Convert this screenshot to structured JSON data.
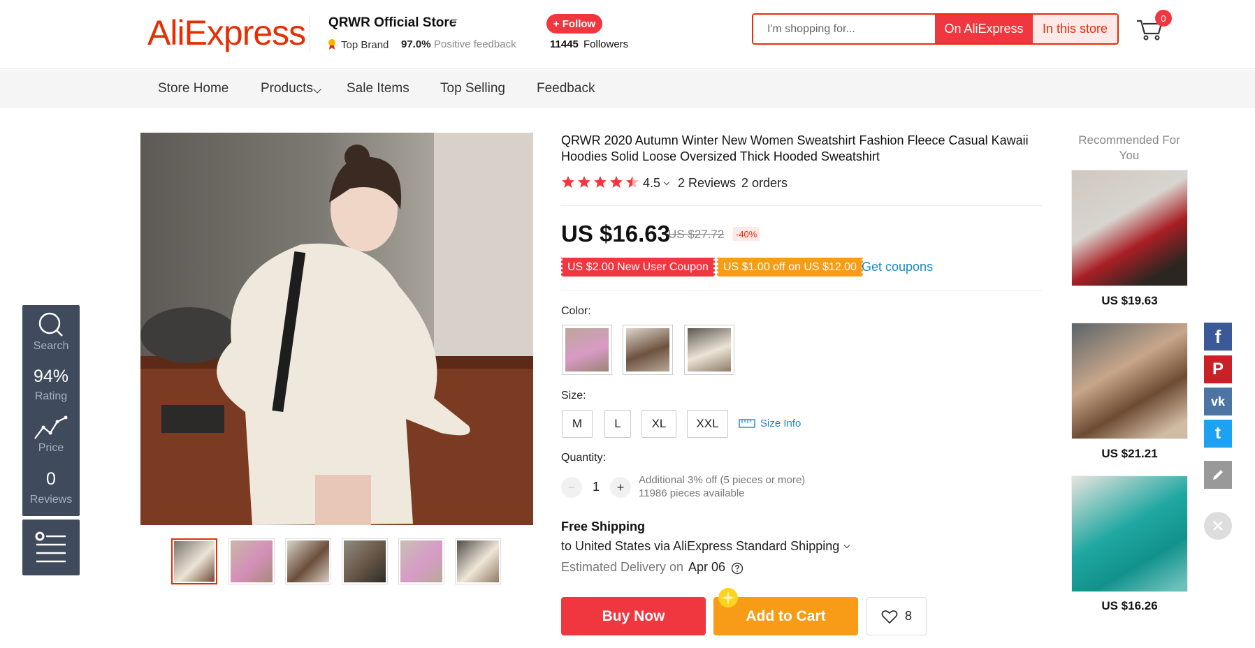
{
  "header": {
    "logo": "AliExpress",
    "store_name": "QRWR Official Store",
    "top_brand": "Top Brand",
    "feedback_value": "97.0%",
    "feedback_label": "Positive feedback",
    "follow_label": "+ Follow",
    "followers_count": "11445",
    "followers_label": "Followers",
    "search_placeholder": "I'm shopping for...",
    "search_ali_label": "On AliExpress",
    "search_store_label": "In this store",
    "cart_count": "0"
  },
  "nav": {
    "items": [
      "Store Home",
      "Products",
      "Sale Items",
      "Top Selling",
      "Feedback"
    ]
  },
  "side_bar": {
    "search_label": "Search",
    "rating_value": "94%",
    "rating_label": "Rating",
    "price_label": "Price",
    "reviews_value": "0",
    "reviews_label": "Reviews"
  },
  "product": {
    "title": "QRWR 2020 Autumn Winter New Women Sweatshirt Fashion Fleece Casual Kawaii Hoodies Solid Loose Oversized Thick Hooded Sweatshirt",
    "rating_stars": 4.5,
    "rating_value": "4.5",
    "reviews": "2 Reviews",
    "orders": "2 orders",
    "price": "US $16.63",
    "original_price": "US $27.72",
    "discount": "-40%",
    "coupon_1": "US $2.00 New User Coupon",
    "coupon_2": "US $1.00 off on US $12.00",
    "get_coupons": "Get coupons",
    "color_label": "Color:",
    "size_label": "Size:",
    "sizes": [
      "M",
      "L",
      "XL",
      "XXL"
    ],
    "size_info": "Size Info",
    "quantity_label": "Quantity:",
    "quantity_minus": "−",
    "quantity_plus": "+",
    "quantity": "1",
    "quantity_note": "Additional 3% off (5 pieces or more)",
    "quantity_available": "11986 pieces available",
    "free_shipping": "Free Shipping",
    "shipping_dest": "to United States via AliExpress Standard Shipping",
    "estimated_label": "Estimated Delivery on",
    "estimated_date": "Apr 06",
    "buy_now": "Buy Now",
    "add_to_cart": "Add to Cart",
    "wishlist_count": "8"
  },
  "recommended": {
    "title": "Recommended For You",
    "items": [
      {
        "price": "US $19.63"
      },
      {
        "price": "US $21.21"
      },
      {
        "price": "US $16.26"
      }
    ]
  },
  "social": {
    "facebook": "f",
    "pinterest": "P",
    "vk": "vk",
    "twitter": "t"
  },
  "colors": {
    "brand": "#e62e04",
    "accent_red": "#f0373f",
    "accent_orange": "#f89b17",
    "link_blue": "#1a88c9"
  }
}
